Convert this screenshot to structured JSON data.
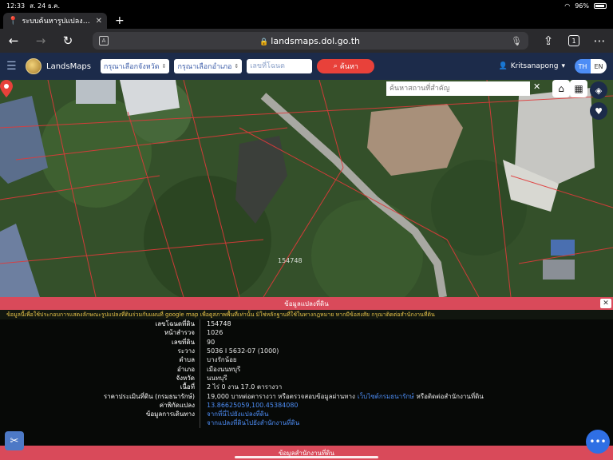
{
  "status": {
    "time": "12:33",
    "date": "ส. 24 ธ.ค.",
    "battery": "96%"
  },
  "tab": {
    "title": "ระบบค้นหารูปแปลงที่ดิน (L..."
  },
  "browser": {
    "url": "landsmaps.dol.go.th",
    "tab_count": "1"
  },
  "app": {
    "brand": "LandsMaps",
    "province_placeholder": "กรุณาเลือกจังหวัด",
    "district_placeholder": "กรุณาเลือกอำเภอ",
    "deed_placeholder": "เลขที่โฉนด",
    "search_label": "ค้นหา",
    "user": "Kritsanapong",
    "lang_th": "TH",
    "lang_en": "EN"
  },
  "map": {
    "place_search_placeholder": "ค้นหาสถานที่สำคัญ",
    "marker_label": "154748"
  },
  "panel": {
    "header": "ข้อมูลแปลงที่ดิน",
    "notice": "ข้อมูลนี้เพื่อใช้ประกอบการแสดงลักษณะรูปแปลงที่ดินร่วมกับแผนที่ google map เพื่อดูสภาพพื้นที่เท่านั้น มิใช่หลักฐานที่ใช้ในทางกฎหมาย หากมีข้อสงสัย กรุณาติดต่อสำนักงานที่ดิน",
    "rows": [
      {
        "label": "เลขโฉนดที่ดิน",
        "value": "154748"
      },
      {
        "label": "หน้าสำรวจ",
        "value": "1026"
      },
      {
        "label": "เลขที่ดิน",
        "value": "90"
      },
      {
        "label": "ระวาง",
        "value": "5036 I 5632-07 (1000)"
      },
      {
        "label": "ตำบล",
        "value": "บางรักน้อย"
      },
      {
        "label": "อำเภอ",
        "value": "เมืองนนทบุรี"
      },
      {
        "label": "จังหวัด",
        "value": "นนทบุรี"
      },
      {
        "label": "เนื้อที่",
        "value": "2 ไร่ 0 งาน 17.0 ตารางวา"
      }
    ],
    "price_label": "ราคาประเมินที่ดิน (กรมธนารักษ์)",
    "price_pre": "19,000 บาทต่อตารางวา หรือตรวจสอบข้อมูลผ่านทาง",
    "price_link": "เว็บไซต์กรมธนารักษ์",
    "price_post": "หรือติดต่อสำนักงานที่ดิน",
    "coord_label": "ค่าพิกัดแปลง",
    "coord_value": "13.86625059,100.45384080",
    "route_label": "ข้อมูลการเดินทาง",
    "route_1": "จากที่นี่ไปยังแปลงที่ดิน",
    "route_2": "จากแปลงที่ดินไปยังสำนักงานที่ดิน",
    "footer": "ข้อมูลสำนักงานที่ดิน"
  },
  "icons": [
    "location-pin-icon",
    "back-icon",
    "forward-icon",
    "reload-icon",
    "translate-icon",
    "lock-icon",
    "mic-icon",
    "share-icon",
    "tabs-icon",
    "more-icon",
    "hamburger-icon",
    "user-icon",
    "home-icon",
    "grid-icon",
    "layers-icon",
    "heart-icon",
    "tools-icon",
    "more-fab-icon"
  ],
  "colors": {
    "appbar": "#1c2b4a",
    "accent_red": "#d94a5a",
    "search_red": "#e8413a",
    "link_blue": "#4d8df5",
    "notice_yellow": "#e6c34a",
    "parcel_line": "#e03a3a"
  }
}
